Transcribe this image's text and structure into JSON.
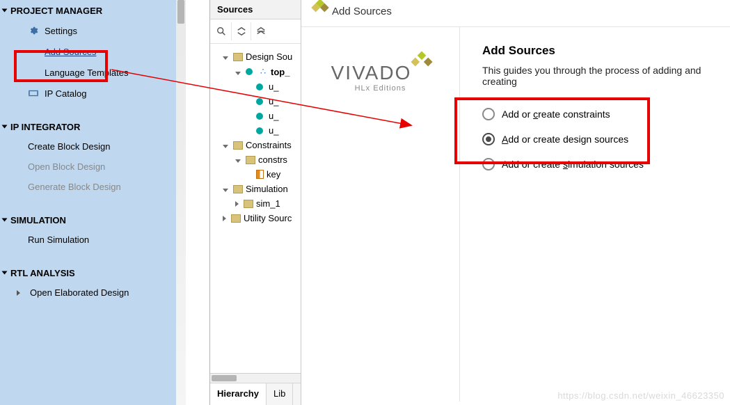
{
  "sidebar": {
    "sections": [
      {
        "title": "PROJECT MANAGER",
        "items": [
          {
            "label": "Settings",
            "icon": "gear-icon",
            "kind": "normal"
          },
          {
            "label": "Add Sources",
            "icon": null,
            "kind": "link"
          },
          {
            "label": "Language Templates",
            "icon": null,
            "kind": "normal"
          },
          {
            "label": "IP Catalog",
            "icon": "ip-icon",
            "kind": "normal"
          }
        ]
      },
      {
        "title": "IP INTEGRATOR",
        "items": [
          {
            "label": "Create Block Design",
            "kind": "normal"
          },
          {
            "label": "Open Block Design",
            "kind": "disabled"
          },
          {
            "label": "Generate Block Design",
            "kind": "disabled"
          }
        ]
      },
      {
        "title": "SIMULATION",
        "items": [
          {
            "label": "Run Simulation",
            "kind": "normal"
          }
        ]
      },
      {
        "title": "RTL ANALYSIS",
        "items": [
          {
            "label": "Open Elaborated Design",
            "kind": "expandable"
          }
        ]
      }
    ]
  },
  "sources": {
    "panel_title": "Sources",
    "toolbar": {
      "search": "search-icon",
      "collapse": "collapse-icon",
      "expand": "expand-icon"
    },
    "tree": [
      {
        "depth": 1,
        "expand": "open",
        "icon": "folder",
        "label": "Design Sou"
      },
      {
        "depth": 2,
        "expand": "open",
        "icon": "hier",
        "label": "top_",
        "bold": true
      },
      {
        "depth": 3,
        "expand": "",
        "icon": "dot",
        "label": "u_"
      },
      {
        "depth": 3,
        "expand": "",
        "icon": "dot",
        "label": "u_"
      },
      {
        "depth": 3,
        "expand": "",
        "icon": "dot",
        "label": "u_"
      },
      {
        "depth": 3,
        "expand": "",
        "icon": "dot",
        "label": "u_"
      },
      {
        "depth": 1,
        "expand": "open",
        "icon": "folder",
        "label": "Constraints"
      },
      {
        "depth": 2,
        "expand": "open",
        "icon": "folder",
        "label": "constrs"
      },
      {
        "depth": 3,
        "expand": "",
        "icon": "file-orange",
        "label": "key"
      },
      {
        "depth": 1,
        "expand": "open",
        "icon": "folder",
        "label": "Simulation "
      },
      {
        "depth": 2,
        "expand": "closed",
        "icon": "folder",
        "label": "sim_1"
      },
      {
        "depth": 1,
        "expand": "closed",
        "icon": "folder",
        "label": "Utility Sourc"
      }
    ],
    "tabs": {
      "active": "Hierarchy",
      "other": "Lib"
    }
  },
  "dialog": {
    "window_title": "Add Sources",
    "branding_top": "VIVADO",
    "branding_sub": "HLx Editions",
    "heading": "Add Sources",
    "description": "This guides you through the process of adding and creating",
    "options": [
      {
        "pre": "Add or ",
        "key": "c",
        "post": "reate constraints",
        "selected": false
      },
      {
        "pre": "",
        "key": "A",
        "post": "dd or create design sources",
        "selected": true
      },
      {
        "pre": "Add or create ",
        "key": "s",
        "post": "imulation sources",
        "selected": false
      }
    ]
  },
  "watermark": "https://blog.csdn.net/weixin_46623350"
}
